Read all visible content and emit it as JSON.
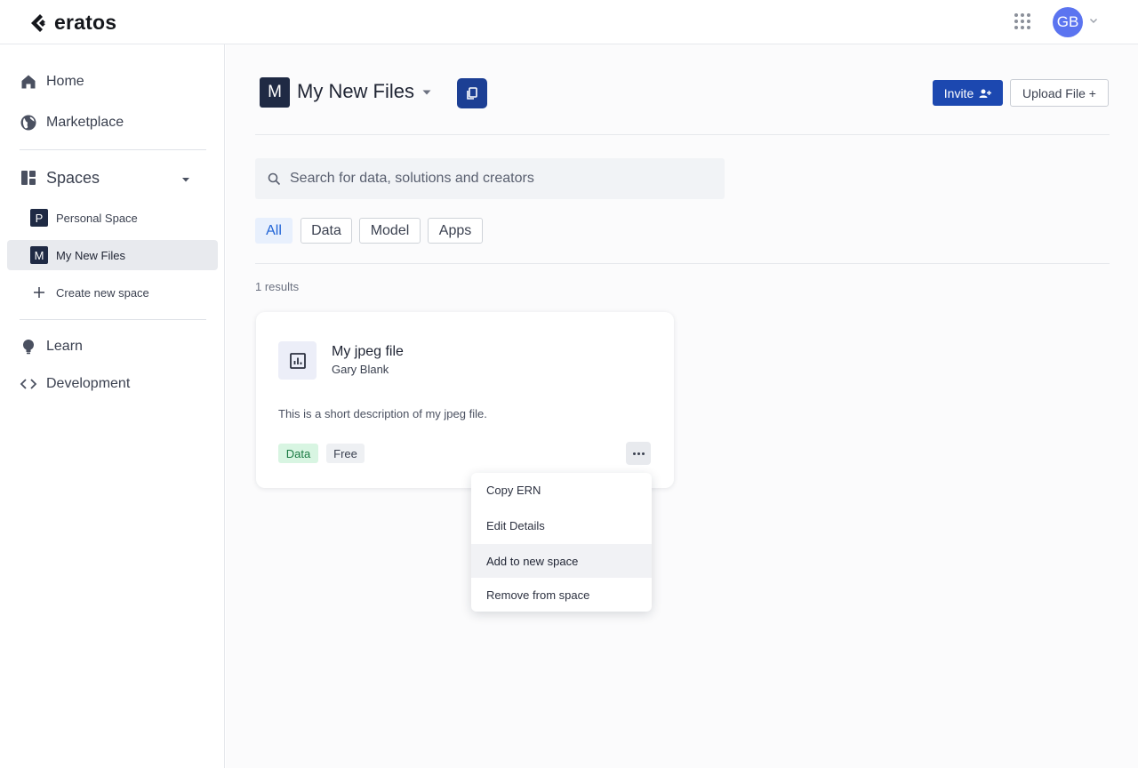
{
  "app": {
    "logo_text": "eratos"
  },
  "header": {
    "avatar_initials": "GB"
  },
  "sidebar": {
    "home": "Home",
    "marketplace": "Marketplace",
    "spaces": "Spaces",
    "space_items": [
      {
        "badge": "P",
        "label": "Personal Space"
      },
      {
        "badge": "M",
        "label": "My New Files"
      }
    ],
    "create_space": "Create new space",
    "learn": "Learn",
    "development": "Development"
  },
  "main": {
    "title_badge": "M",
    "title": "My New Files",
    "invite_label": "Invite",
    "upload_label": "Upload File +",
    "search_placeholder": "Search for data, solutions and creators",
    "filters": [
      "All",
      "Data",
      "Model",
      "Apps"
    ],
    "active_filter": "All",
    "results_text": "1 results"
  },
  "card": {
    "title": "My jpeg file",
    "author": "Gary Blank",
    "description": "This is a short description of my jpeg file.",
    "tags": [
      "Data",
      "Free"
    ]
  },
  "menu": {
    "items": [
      "Copy ERN",
      "Edit Details",
      "Add to new space",
      "Remove from space"
    ],
    "hovered": "Add to new space"
  },
  "colors": {
    "primary": "#1c48b0",
    "navy": "#1f2a44",
    "avatar": "#5b74f0",
    "active_filter_bg": "#e8f0fd",
    "tag_data_bg": "#d8f5e2"
  }
}
